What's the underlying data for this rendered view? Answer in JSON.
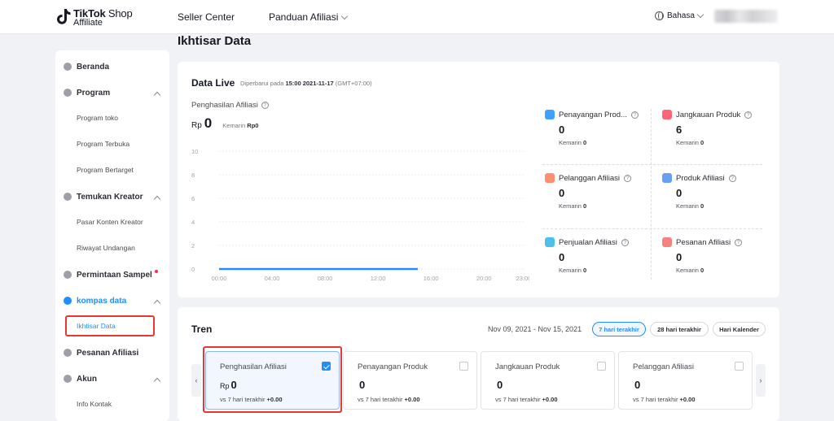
{
  "brand": {
    "line1_bold": "TikTok",
    "line1_rest": " Shop",
    "line2": "Affiliate"
  },
  "nav": {
    "seller_center": "Seller Center",
    "panduan": "Panduan Afiliasi",
    "language": "Bahasa"
  },
  "page_title": "Ikhtisar Data",
  "sidebar": {
    "items": [
      {
        "label": "Beranda"
      },
      {
        "label": "Program"
      },
      {
        "label": "Program toko"
      },
      {
        "label": "Program Terbuka"
      },
      {
        "label": "Program Bertarget"
      },
      {
        "label": "Temukan Kreator"
      },
      {
        "label": "Pasar Konten Kreator"
      },
      {
        "label": "Riwayat Undangan"
      },
      {
        "label": "Permintaan Sampel"
      },
      {
        "label": "kompas data"
      },
      {
        "label": "Ikhtisar Data"
      },
      {
        "label": "Pesanan Afiliasi"
      },
      {
        "label": "Akun"
      },
      {
        "label": "Info Kontak"
      }
    ]
  },
  "live": {
    "title": "Data Live",
    "updated_prefix": "Diperbarui pada ",
    "updated_time": "15:00 2021-11-17",
    "updated_tz": " (GMT+07:00)",
    "metric_label": "Penghasilan Afiliasi",
    "currency": "Rp",
    "metric_value": "0",
    "kemarin_label": "Kemarin",
    "kemarin_value": "Rp0",
    "stats": [
      {
        "label": "Penayangan Prod...",
        "value": "0",
        "kemarin": "Kemarin",
        "kemarin_value": "0",
        "color": "#1e8fff"
      },
      {
        "label": "Jangkauan Produk",
        "value": "6",
        "kemarin": "Kemarin",
        "kemarin_value": "0",
        "color": "#fe4a5f"
      },
      {
        "label": "Pelanggan Afiliasi",
        "value": "0",
        "kemarin": "Kemarin",
        "kemarin_value": "0",
        "color": "#ff7a59"
      },
      {
        "label": "Produk Afiliasi",
        "value": "0",
        "kemarin": "Kemarin",
        "kemarin_value": "0",
        "color": "#4b8ef5"
      },
      {
        "label": "Penjualan Afiliasi",
        "value": "0",
        "kemarin": "Kemarin",
        "kemarin_value": "0",
        "color": "#2fb4e6"
      },
      {
        "label": "Pesanan Afiliasi",
        "value": "0",
        "kemarin": "Kemarin",
        "kemarin_value": "0",
        "color": "#f36b6b"
      }
    ]
  },
  "chart_data": {
    "type": "line",
    "x": [
      "00:00",
      "04:00",
      "08:00",
      "12:00",
      "16:00",
      "20:00",
      "23:00"
    ],
    "yticks": [
      "0",
      "2",
      "4",
      "6",
      "8",
      "10"
    ],
    "ylim": [
      0,
      10
    ],
    "series": [
      {
        "x_start": "00:00",
        "x_end": "15:00",
        "value": 0,
        "color": "#1e8fff"
      }
    ]
  },
  "tren": {
    "title": "Tren",
    "date_range": "Nov 09, 2021 - Nov 15, 2021",
    "pills": [
      "7 hari terakhir",
      "28 hari terakhir",
      "Hari Kalender"
    ],
    "cards": [
      {
        "name": "Penghasilan Afiliasi",
        "currency": "Rp",
        "value": "0",
        "vs": "vs 7 hari terakhir",
        "delta": "+0.00",
        "checked": true
      },
      {
        "name": "Penayangan Produk",
        "currency": "",
        "value": "0",
        "vs": "vs 7 hari terakhir",
        "delta": "+0.00",
        "checked": false
      },
      {
        "name": "Jangkauan Produk",
        "currency": "",
        "value": "0",
        "vs": "vs 7 hari terakhir",
        "delta": "+0.00",
        "checked": false
      },
      {
        "name": "Pelanggan Afiliasi",
        "currency": "",
        "value": "0",
        "vs": "vs 7 hari terakhir",
        "delta": "+0.00",
        "checked": false
      }
    ],
    "prev_arrow": "‹",
    "next_arrow": "›"
  }
}
